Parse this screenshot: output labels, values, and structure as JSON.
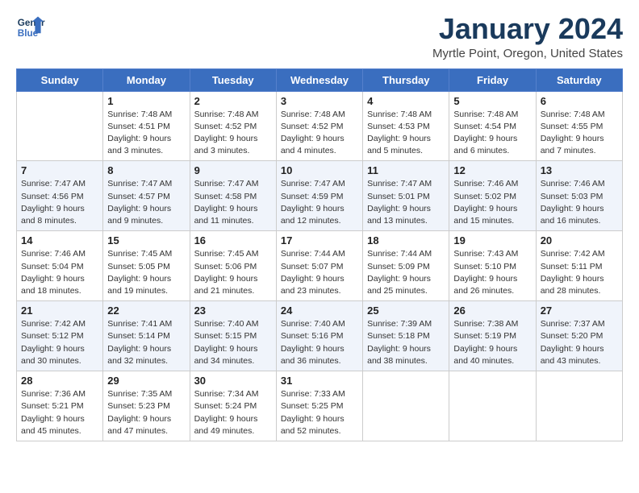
{
  "header": {
    "logo_line1": "General",
    "logo_line2": "Blue",
    "title": "January 2024",
    "subtitle": "Myrtle Point, Oregon, United States"
  },
  "days_of_week": [
    "Sunday",
    "Monday",
    "Tuesday",
    "Wednesday",
    "Thursday",
    "Friday",
    "Saturday"
  ],
  "weeks": [
    [
      {
        "day": "",
        "info": ""
      },
      {
        "day": "1",
        "info": "Sunrise: 7:48 AM\nSunset: 4:51 PM\nDaylight: 9 hours\nand 3 minutes."
      },
      {
        "day": "2",
        "info": "Sunrise: 7:48 AM\nSunset: 4:52 PM\nDaylight: 9 hours\nand 3 minutes."
      },
      {
        "day": "3",
        "info": "Sunrise: 7:48 AM\nSunset: 4:52 PM\nDaylight: 9 hours\nand 4 minutes."
      },
      {
        "day": "4",
        "info": "Sunrise: 7:48 AM\nSunset: 4:53 PM\nDaylight: 9 hours\nand 5 minutes."
      },
      {
        "day": "5",
        "info": "Sunrise: 7:48 AM\nSunset: 4:54 PM\nDaylight: 9 hours\nand 6 minutes."
      },
      {
        "day": "6",
        "info": "Sunrise: 7:48 AM\nSunset: 4:55 PM\nDaylight: 9 hours\nand 7 minutes."
      }
    ],
    [
      {
        "day": "7",
        "info": "Sunrise: 7:47 AM\nSunset: 4:56 PM\nDaylight: 9 hours\nand 8 minutes."
      },
      {
        "day": "8",
        "info": "Sunrise: 7:47 AM\nSunset: 4:57 PM\nDaylight: 9 hours\nand 9 minutes."
      },
      {
        "day": "9",
        "info": "Sunrise: 7:47 AM\nSunset: 4:58 PM\nDaylight: 9 hours\nand 11 minutes."
      },
      {
        "day": "10",
        "info": "Sunrise: 7:47 AM\nSunset: 4:59 PM\nDaylight: 9 hours\nand 12 minutes."
      },
      {
        "day": "11",
        "info": "Sunrise: 7:47 AM\nSunset: 5:01 PM\nDaylight: 9 hours\nand 13 minutes."
      },
      {
        "day": "12",
        "info": "Sunrise: 7:46 AM\nSunset: 5:02 PM\nDaylight: 9 hours\nand 15 minutes."
      },
      {
        "day": "13",
        "info": "Sunrise: 7:46 AM\nSunset: 5:03 PM\nDaylight: 9 hours\nand 16 minutes."
      }
    ],
    [
      {
        "day": "14",
        "info": "Sunrise: 7:46 AM\nSunset: 5:04 PM\nDaylight: 9 hours\nand 18 minutes."
      },
      {
        "day": "15",
        "info": "Sunrise: 7:45 AM\nSunset: 5:05 PM\nDaylight: 9 hours\nand 19 minutes."
      },
      {
        "day": "16",
        "info": "Sunrise: 7:45 AM\nSunset: 5:06 PM\nDaylight: 9 hours\nand 21 minutes."
      },
      {
        "day": "17",
        "info": "Sunrise: 7:44 AM\nSunset: 5:07 PM\nDaylight: 9 hours\nand 23 minutes."
      },
      {
        "day": "18",
        "info": "Sunrise: 7:44 AM\nSunset: 5:09 PM\nDaylight: 9 hours\nand 25 minutes."
      },
      {
        "day": "19",
        "info": "Sunrise: 7:43 AM\nSunset: 5:10 PM\nDaylight: 9 hours\nand 26 minutes."
      },
      {
        "day": "20",
        "info": "Sunrise: 7:42 AM\nSunset: 5:11 PM\nDaylight: 9 hours\nand 28 minutes."
      }
    ],
    [
      {
        "day": "21",
        "info": "Sunrise: 7:42 AM\nSunset: 5:12 PM\nDaylight: 9 hours\nand 30 minutes."
      },
      {
        "day": "22",
        "info": "Sunrise: 7:41 AM\nSunset: 5:14 PM\nDaylight: 9 hours\nand 32 minutes."
      },
      {
        "day": "23",
        "info": "Sunrise: 7:40 AM\nSunset: 5:15 PM\nDaylight: 9 hours\nand 34 minutes."
      },
      {
        "day": "24",
        "info": "Sunrise: 7:40 AM\nSunset: 5:16 PM\nDaylight: 9 hours\nand 36 minutes."
      },
      {
        "day": "25",
        "info": "Sunrise: 7:39 AM\nSunset: 5:18 PM\nDaylight: 9 hours\nand 38 minutes."
      },
      {
        "day": "26",
        "info": "Sunrise: 7:38 AM\nSunset: 5:19 PM\nDaylight: 9 hours\nand 40 minutes."
      },
      {
        "day": "27",
        "info": "Sunrise: 7:37 AM\nSunset: 5:20 PM\nDaylight: 9 hours\nand 43 minutes."
      }
    ],
    [
      {
        "day": "28",
        "info": "Sunrise: 7:36 AM\nSunset: 5:21 PM\nDaylight: 9 hours\nand 45 minutes."
      },
      {
        "day": "29",
        "info": "Sunrise: 7:35 AM\nSunset: 5:23 PM\nDaylight: 9 hours\nand 47 minutes."
      },
      {
        "day": "30",
        "info": "Sunrise: 7:34 AM\nSunset: 5:24 PM\nDaylight: 9 hours\nand 49 minutes."
      },
      {
        "day": "31",
        "info": "Sunrise: 7:33 AM\nSunset: 5:25 PM\nDaylight: 9 hours\nand 52 minutes."
      },
      {
        "day": "",
        "info": ""
      },
      {
        "day": "",
        "info": ""
      },
      {
        "day": "",
        "info": ""
      }
    ]
  ]
}
